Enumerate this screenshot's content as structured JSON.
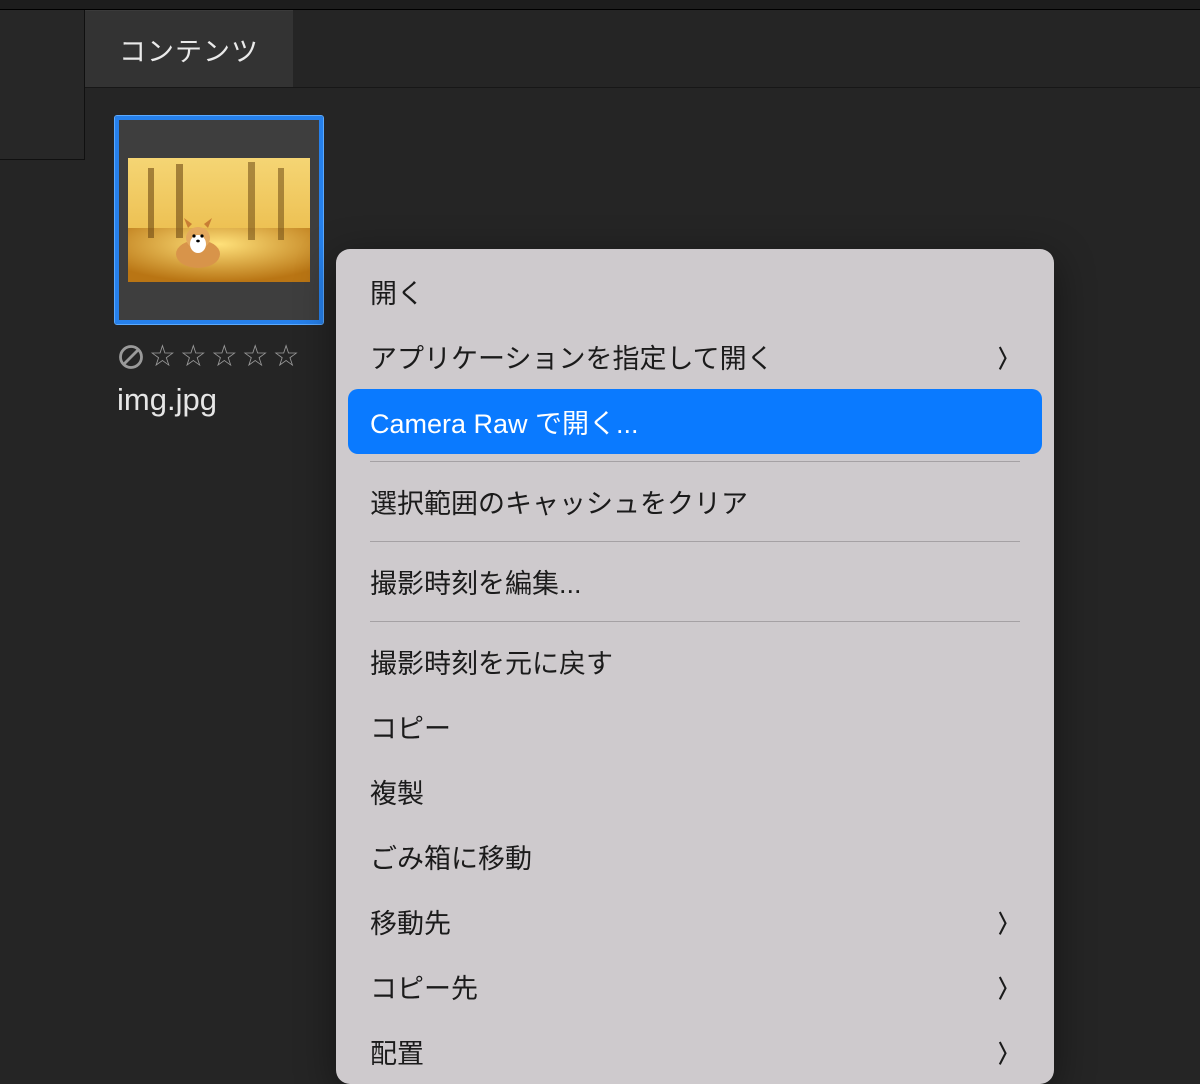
{
  "colors": {
    "selection": "#2680eb",
    "menu_highlight": "#0a7aff",
    "menu_bg": "#cecacd",
    "panel_bg": "#252525"
  },
  "panel": {
    "tab_label": "コンテンツ"
  },
  "thumbnail": {
    "filename": "img.jpg",
    "rating_stars": 5
  },
  "context_menu": {
    "items": [
      {
        "label": "開く",
        "submenu": false,
        "highlighted": false
      },
      {
        "label": "アプリケーションを指定して開く",
        "submenu": true,
        "highlighted": false
      },
      {
        "label": "Camera Raw で開く...",
        "submenu": false,
        "highlighted": true
      },
      {
        "separator": true
      },
      {
        "label": "選択範囲のキャッシュをクリア",
        "submenu": false,
        "highlighted": false
      },
      {
        "separator": true
      },
      {
        "label": "撮影時刻を編集...",
        "submenu": false,
        "highlighted": false
      },
      {
        "separator": true
      },
      {
        "label": "撮影時刻を元に戻す",
        "submenu": false,
        "highlighted": false
      },
      {
        "label": "コピー",
        "submenu": false,
        "highlighted": false
      },
      {
        "label": "複製",
        "submenu": false,
        "highlighted": false
      },
      {
        "label": "ごみ箱に移動",
        "submenu": false,
        "highlighted": false
      },
      {
        "label": "移動先",
        "submenu": true,
        "highlighted": false
      },
      {
        "label": "コピー先",
        "submenu": true,
        "highlighted": false
      },
      {
        "label": "配置",
        "submenu": true,
        "highlighted": false
      }
    ]
  }
}
